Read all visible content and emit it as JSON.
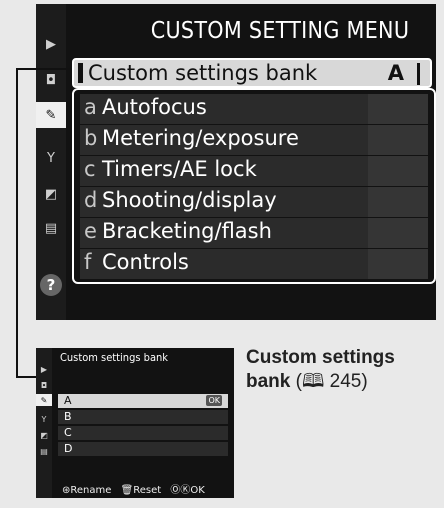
{
  "main": {
    "title": "CUSTOM SETTING MENU",
    "sidebar_icons": [
      "playback-icon",
      "camera-icon",
      "pencil-icon",
      "wrench-icon",
      "retouch-icon",
      "my-menu-icon"
    ],
    "active_sidebar_icon": "pencil-icon",
    "bank": {
      "label": "Custom settings bank",
      "value": "A"
    },
    "groups": [
      {
        "letter": "a",
        "name": "Autofocus"
      },
      {
        "letter": "b",
        "name": "Metering/exposure"
      },
      {
        "letter": "c",
        "name": "Timers/AE lock"
      },
      {
        "letter": "d",
        "name": "Shooting/display"
      },
      {
        "letter": "e",
        "name": "Bracketing/flash"
      },
      {
        "letter": "f",
        "name": "Controls"
      }
    ],
    "help": "?"
  },
  "sub": {
    "title": "Custom settings bank",
    "options": [
      "A",
      "B",
      "C",
      "D"
    ],
    "selected": "A",
    "ok_badge": "OK",
    "footer": {
      "rename": "⊛Rename",
      "reset": "🗑Reset",
      "ok": "ⓄⓀOK"
    }
  },
  "caption": {
    "title": "Custom settings",
    "title2": "bank",
    "reference": "(🕮 245)"
  }
}
